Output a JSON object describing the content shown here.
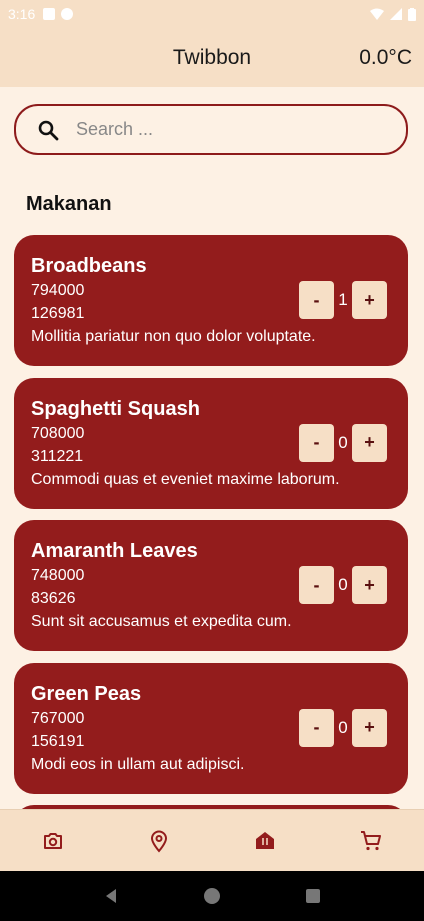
{
  "status_bar": {
    "time": "3:16"
  },
  "app_bar": {
    "title": "Twibbon",
    "temperature": "0.0°C"
  },
  "search": {
    "placeholder": "Search ..."
  },
  "section": {
    "title": "Makanan"
  },
  "items": [
    {
      "name": "Broadbeans",
      "line2": "794000",
      "line3": "126981",
      "description": "Mollitia pariatur non quo dolor voluptate.",
      "qty": "1"
    },
    {
      "name": "Spaghetti Squash",
      "line2": "708000",
      "line3": "311221",
      "description": "Commodi quas et eveniet maxime laborum.",
      "qty": "0"
    },
    {
      "name": "Amaranth Leaves",
      "line2": "748000",
      "line3": "83626",
      "description": "Sunt sit accusamus et expedita cum.",
      "qty": "0"
    },
    {
      "name": "Green Peas",
      "line2": "767000",
      "line3": "156191",
      "description": "Modi eos in ullam aut adipisci.",
      "qty": "0"
    }
  ],
  "stepper": {
    "minus_label": "-",
    "plus_label": "+"
  },
  "bottom_nav": [
    {
      "icon": "camera-icon",
      "active": false
    },
    {
      "icon": "location-pin-icon",
      "active": false
    },
    {
      "icon": "restaurant-icon",
      "active": true
    },
    {
      "icon": "cart-icon",
      "active": false
    }
  ],
  "colors": {
    "primary": "#931c1c",
    "app_bar_bg": "#f6dfc6",
    "page_bg": "#fdf1e4",
    "button_bg": "#f6dfc6"
  }
}
